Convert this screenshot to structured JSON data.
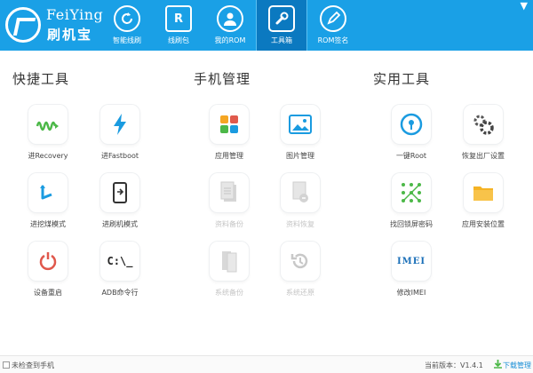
{
  "app": {
    "brand_en": "FeiYing",
    "brand_cn": "刷机宝",
    "accent": "#1aa0e6",
    "accent_dark": "#0b79c0"
  },
  "nav": [
    {
      "label": "智能线刷",
      "icon": "refresh-icon"
    },
    {
      "label": "线刷包",
      "icon": "package-r-icon",
      "glyph": "R"
    },
    {
      "label": "我的ROM",
      "icon": "user-icon"
    },
    {
      "label": "工具箱",
      "icon": "wrench-icon",
      "active": true
    },
    {
      "label": "ROM签名",
      "icon": "pen-icon"
    }
  ],
  "sections": {
    "quick": {
      "title": "快捷工具",
      "tools": [
        {
          "label": "进Recovery",
          "icon": "recovery-wave-icon"
        },
        {
          "label": "进Fastboot",
          "icon": "lightning-icon"
        },
        {
          "label": "进挖煤模式",
          "icon": "download-mode-icon"
        },
        {
          "label": "进刷机模式",
          "icon": "flash-mode-phone-icon"
        },
        {
          "label": "设备重启",
          "icon": "restart-icon"
        },
        {
          "label": "ADB命令行",
          "icon": "terminal-icon",
          "glyph": "C:\\_"
        }
      ]
    },
    "phone": {
      "title": "手机管理",
      "tools": [
        {
          "label": "应用管理",
          "icon": "apps-grid-icon"
        },
        {
          "label": "图片管理",
          "icon": "image-icon"
        },
        {
          "label": "资料备份",
          "icon": "document-backup-icon",
          "disabled": true
        },
        {
          "label": "资料恢复",
          "icon": "document-restore-icon",
          "disabled": true
        },
        {
          "label": "系统备份",
          "icon": "system-backup-icon",
          "disabled": true
        },
        {
          "label": "系统还原",
          "icon": "system-restore-icon",
          "disabled": true
        }
      ]
    },
    "utility": {
      "title": "实用工具",
      "tools": [
        {
          "label": "一键Root",
          "icon": "root-lock-icon"
        },
        {
          "label": "恢复出厂设置",
          "icon": "gears-icon"
        },
        {
          "label": "找回锁屏密码",
          "icon": "pattern-lock-icon"
        },
        {
          "label": "应用安装位置",
          "icon": "folder-icon"
        },
        {
          "label": "修改IMEI",
          "icon": "imei-pen-icon",
          "glyph": "IMEI"
        }
      ]
    }
  },
  "footer": {
    "status": "未检查到手机",
    "version": "当前版本：V1.4.1",
    "download_label": "下载管理"
  }
}
